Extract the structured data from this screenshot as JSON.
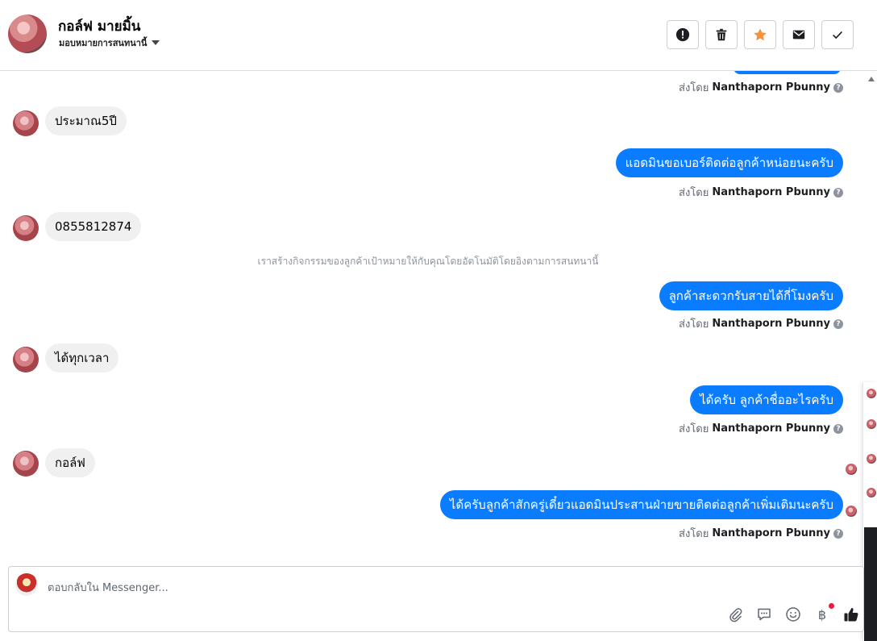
{
  "header": {
    "contact_name": "กอล์ฟ มายมิ้น",
    "assign_label": "มอบหมายการสนทนานี้",
    "icons": [
      "alert-icon",
      "trash-icon",
      "star-icon",
      "envelope-icon",
      "check-icon"
    ],
    "star_color": "#f7923a"
  },
  "messages": {
    "sent_by_label": "ส่งโดย",
    "agent_name": "Nanthaporn Pbunny",
    "m1": "ประมาณ5ปี",
    "m2": "แอดมินขอเบอร์ติดต่อลูกค้าหน่อยนะครับ",
    "m3": "0855812874",
    "system": "เราสร้างกิจกรรมของลูกค้าเป้าหมายให้กับคุณโดยอัตโนมัติโดยอิงตามการสนทนานี้",
    "m4": "ลูกค้าสะดวกรับสายได้กี่โมงครับ",
    "m5": "ได้ทุกเวลา",
    "m6": "ได้ครับ ลูกค้าชื่ออะไรครับ",
    "m7": "กอล์ฟ",
    "m8": "ได้ครับลูกค้าสักครู่เดี๋ยวแอดมินประสานฝ่ายขายติดต่อลูกค้าเพิ่มเติมนะครับ",
    "sent_bubble_color": "#0a7cff",
    "received_bubble_color": "#f0f0f0"
  },
  "composer": {
    "placeholder": "ตอบกลับใน Messenger...",
    "tools": [
      "paperclip-icon",
      "saved-replies-icon",
      "emoji-icon",
      "baht-payment-icon",
      "like-icon"
    ]
  }
}
